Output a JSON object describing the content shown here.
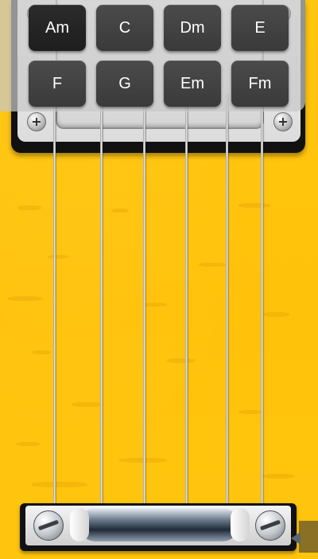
{
  "app": {
    "theme_color": "#ffc40d"
  },
  "chord_selector": {
    "selected": "Am",
    "chords": [
      {
        "label": "Am"
      },
      {
        "label": "C"
      },
      {
        "label": "Dm"
      },
      {
        "label": "E"
      },
      {
        "label": "F"
      },
      {
        "label": "G"
      },
      {
        "label": "Em"
      },
      {
        "label": "Fm"
      }
    ]
  },
  "strings": {
    "count": 6
  },
  "icons": {
    "pickup_screws": "plus-screw-icon",
    "bridge_screws": "flathead-screw-icon",
    "side_tab": "arrow-left-icon"
  }
}
